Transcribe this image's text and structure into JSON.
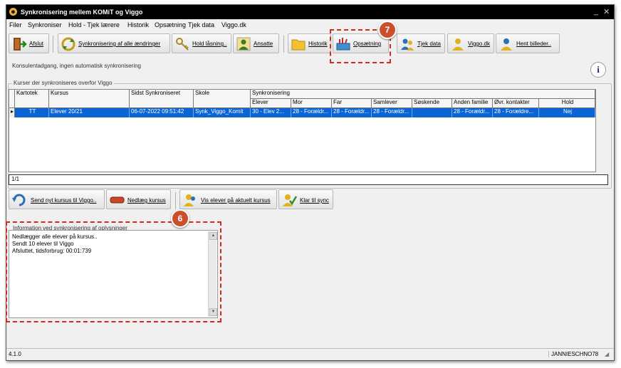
{
  "window": {
    "title": "Synkronisering mellem KOMiT og Viggo",
    "minimize": "_",
    "close": "✕"
  },
  "menu": [
    "Filer",
    "Synkroniser",
    "Hold - Tjek lærere",
    "Historik",
    "Opsætning",
    "Tjek data",
    "Viggo.dk"
  ],
  "toolbar": {
    "afslut": "Afslut",
    "sync_all": "Synkronisering af alle ændringer",
    "hold_laasning": "Hold låsning..",
    "ansatte": "Ansatte",
    "historik": "Historik",
    "opsaetning": "Opsætning",
    "tjek_data": "Tjek data",
    "viggo_dk": "Viggo.dk",
    "hent_billeder": "Hent billeder.."
  },
  "status_text": "Konsulentadgang, ingen automatisk synkronisering",
  "info_glyph": "i",
  "courses": {
    "legend": "Kurser der synkroniseres overfor Viggo",
    "columns": {
      "kartotek": "Kartotek",
      "kursus": "Kursus",
      "sidst": "Sidst Synkroniseret",
      "skole": "Skole",
      "synk": "Synkronisering",
      "elever": "Elever",
      "mor": "Mor",
      "far": "Far",
      "samlever": "Samlever",
      "soskende": "Søskende",
      "anden": "Anden familie",
      "ovr": "Øvr. kontakter",
      "hold": "Hold"
    },
    "rows": [
      {
        "kartotek": "TT",
        "kursus": "Elever 20/21",
        "sidst": "06-07-2022 09:51:42",
        "skole": "Synk_Viggo_Komit",
        "elever": "30 - Elev 2...",
        "mor": "28 - Forældr...",
        "far": "28 - Forældr...",
        "samlever": "28 - Forældr...",
        "soskende": "",
        "anden": "28 - Forældr...",
        "ovr": "28 - Forældre...",
        "hold": "Nej"
      }
    ],
    "pager": "1/1"
  },
  "actions": {
    "send_nyt": "Send nyt kursus til Viggo..",
    "nedlaeg": "Nedlæg kursus",
    "vis_elever": "Vis elever på aktuelt kursus",
    "klar_til_sync": "Klar til sync"
  },
  "info_panel": {
    "legend": "Information ved synkronisering af oplysninger",
    "lines": [
      "Nedlægger alle elever på kursus..",
      "Sendt 10 elever til Viggo",
      "Afsluttet, tidsforbrug: 00:01:739"
    ]
  },
  "statusbar": {
    "version": "4.1.0",
    "user": "JANNIESCHNO78"
  },
  "annotations": {
    "badge_7": "7",
    "badge_6": "6",
    "color": "#d42a1e"
  }
}
